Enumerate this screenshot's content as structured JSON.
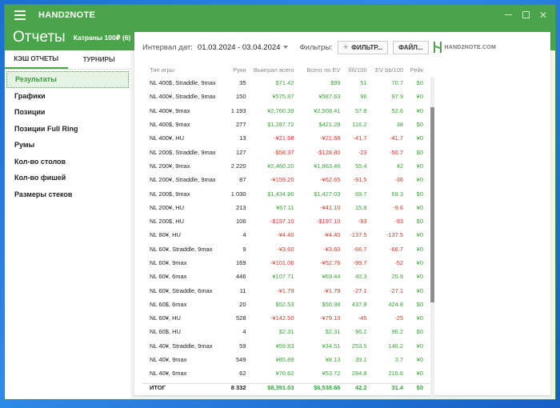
{
  "app": {
    "name": "HAND2NOTE",
    "title": "Отчеты",
    "subtitle": "Катраны 100₽ (6)"
  },
  "sidebar": {
    "tabs": [
      {
        "label": "КЭШ ОТЧЕТЫ"
      },
      {
        "label": "ТУРНИРЫ"
      }
    ],
    "items": [
      {
        "label": "Результаты"
      },
      {
        "label": "Графики"
      },
      {
        "label": "Позиции"
      },
      {
        "label": "Позиции Full Ring"
      },
      {
        "label": "Румы"
      },
      {
        "label": "Кол-во столов"
      },
      {
        "label": "Кол-во фишей"
      },
      {
        "label": "Размеры стеков"
      }
    ]
  },
  "filterbar": {
    "interval_label": "Интервал дат:",
    "date_range": "01.03.2024 - 03.04.2024",
    "filters_label": "Фильтры:",
    "filter_button": "ФИЛЬТР...",
    "file_button": "ФАЙЛ...",
    "logo_text": "HAND2NOTE.COM"
  },
  "table": {
    "headers": [
      "Тип игры",
      "Руки",
      "Выиграл всего",
      "Всего по EV",
      "бб/100",
      "EV bb/100",
      "Рейк"
    ],
    "rows": [
      [
        "NL 400$, Straddle, 9max",
        "35",
        "$71.42",
        "$99",
        "51",
        "70.7",
        "$0"
      ],
      [
        "NL 400¥, Straddle, 9max",
        "150",
        "¥575.87",
        "¥587.63",
        "96",
        "97.9",
        "¥0"
      ],
      [
        "NL 400¥, 9max",
        "1 193",
        "¥2,760.39",
        "¥2,508.41",
        "57.8",
        "52.6",
        "¥0"
      ],
      [
        "NL 400$, 9max",
        "277",
        "$1,287.72",
        "$421.29",
        "116.2",
        "38",
        "$0"
      ],
      [
        "NL 400¥, HU",
        "13",
        "-¥21.68",
        "-¥21.68",
        "-41.7",
        "-41.7",
        "¥0"
      ],
      [
        "NL 200$, Straddle, 9max",
        "127",
        "-$58.37",
        "-$128.80",
        "-23",
        "-50.7",
        "$0"
      ],
      [
        "NL 200¥, 9max",
        "2 220",
        "¥2,460.20",
        "¥1,863.46",
        "55.4",
        "42",
        "¥0"
      ],
      [
        "NL 200¥, Straddle, 9max",
        "87",
        "-¥159.20",
        "-¥62.65",
        "-91.5",
        "-36",
        "¥0"
      ],
      [
        "NL 200$, 9max",
        "1 030",
        "$1,434.96",
        "$1,427.03",
        "69.7",
        "69.3",
        "$0"
      ],
      [
        "NL 200¥, HU",
        "213",
        "¥67.11",
        "-¥41.10",
        "15.8",
        "-9.6",
        "¥0"
      ],
      [
        "NL 200$, HU",
        "106",
        "-$197.10",
        "-$197.10",
        "-93",
        "-93",
        "$0"
      ],
      [
        "NL 80¥, HU",
        "4",
        "-¥4.40",
        "-¥4.40",
        "-137.5",
        "-137.5",
        "¥0"
      ],
      [
        "NL 60¥, Straddle, 9max",
        "9",
        "-¥3.60",
        "-¥3.60",
        "-66.7",
        "-66.7",
        "¥0"
      ],
      [
        "NL 60¥, 9max",
        "169",
        "-¥101.06",
        "-¥52.76",
        "-99.7",
        "-52",
        "¥0"
      ],
      [
        "NL 60¥, 6max",
        "446",
        "¥107.71",
        "¥69.44",
        "40.3",
        "25.9",
        "¥0"
      ],
      [
        "NL 60¥, Straddle, 6max",
        "11",
        "-¥1.79",
        "-¥1.79",
        "-27.1",
        "-27.1",
        "¥0"
      ],
      [
        "NL 60$, 6max",
        "20",
        "$52.53",
        "$50.98",
        "437.8",
        "424.8",
        "$0"
      ],
      [
        "NL 60¥, HU",
        "528",
        "-¥142.50",
        "-¥79.10",
        "-45",
        "-25",
        "¥0"
      ],
      [
        "NL 60$, HU",
        "4",
        "$2.31",
        "$2.31",
        "96.2",
        "96.2",
        "$0"
      ],
      [
        "NL 40¥, Straddle, 9max",
        "59",
        "¥59.83",
        "¥34.51",
        "253.5",
        "146.2",
        "¥0"
      ],
      [
        "NL 40¥, 9max",
        "549",
        "¥85.89",
        "¥8.13",
        "39.1",
        "3.7",
        "¥0"
      ],
      [
        "NL 40¥, 6max",
        "62",
        "¥70.62",
        "¥53.72",
        "284.8",
        "216.6",
        "¥0"
      ]
    ],
    "total": [
      "ИТОГ",
      "8 332",
      "$8,391.03",
      "$6,538.66",
      "42.2",
      "31.4",
      "$0"
    ]
  }
}
